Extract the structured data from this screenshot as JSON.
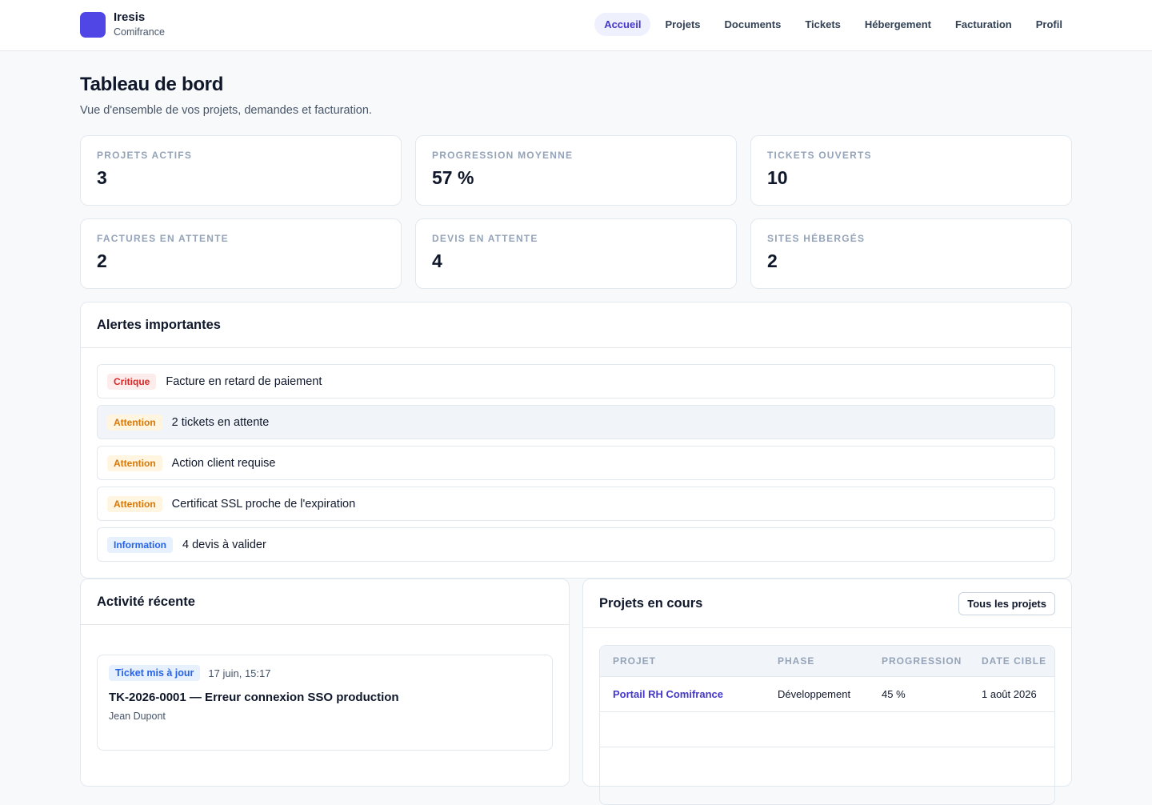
{
  "brand": {
    "name": "Iresis",
    "client": "Comifrance",
    "color": "#4f46e5"
  },
  "nav": {
    "items": [
      {
        "label": "Accueil",
        "active": true
      },
      {
        "label": "Projets"
      },
      {
        "label": "Documents"
      },
      {
        "label": "Tickets"
      },
      {
        "label": "Hébergement"
      },
      {
        "label": "Facturation"
      },
      {
        "label": "Profil"
      }
    ]
  },
  "page": {
    "title": "Tableau de bord",
    "subtitle": "Vue d'ensemble de vos projets, demandes et facturation."
  },
  "stats": [
    {
      "label": "PROJETS ACTIFS",
      "value": "3"
    },
    {
      "label": "PROGRESSION MOYENNE",
      "value": "57 %"
    },
    {
      "label": "TICKETS OUVERTS",
      "value": "10"
    },
    {
      "label": "FACTURES EN ATTENTE",
      "value": "2"
    },
    {
      "label": "DEVIS EN ATTENTE",
      "value": "4"
    },
    {
      "label": "SITES HÉBERGÉS",
      "value": "2"
    }
  ],
  "alerts": {
    "title": "Alertes importantes",
    "items": [
      {
        "severity": "Critique",
        "text": "Facture en retard de paiement"
      },
      {
        "severity": "Attention",
        "text": "2 tickets en attente"
      },
      {
        "severity": "Attention",
        "text": "Action client requise"
      },
      {
        "severity": "Attention",
        "text": "Certificat SSL proche de l'expiration"
      },
      {
        "severity": "Information",
        "text": "4 devis à valider"
      }
    ]
  },
  "activity": {
    "title": "Activité récente",
    "items": [
      {
        "type": "Ticket mis à jour",
        "date": "17 juin, 15:17",
        "title": "TK-2026-0001 — Erreur connexion SSO production",
        "author": "Jean Dupont"
      }
    ]
  },
  "projects": {
    "title": "Projets en cours",
    "all_button": "Tous les projets",
    "columns": [
      "PROJET",
      "PHASE",
      "PROGRESSION",
      "DATE CIBLE"
    ],
    "rows": [
      {
        "name": "Portail RH Comifrance",
        "phase": "Développement",
        "progress": "45 %",
        "target_date": "1 août 2026"
      }
    ]
  }
}
